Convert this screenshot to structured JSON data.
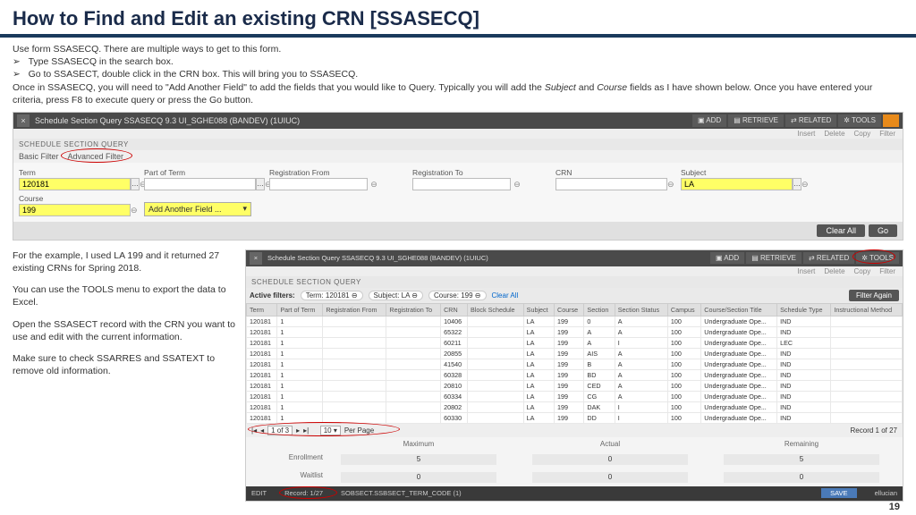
{
  "title": "How to Find and Edit an existing CRN   [SSASECQ]",
  "intro": {
    "l1": "Use form SSASECQ. There are multiple ways to get to this form.",
    "b1": "Type SSASECQ in the search box.",
    "b2": "Go to SSASECT, double click in the CRN box. This will bring you to SSASECQ.",
    "l2a": "Once in SSASECQ, you will need to \"Add Another Field\" to add the fields that you would like to Query. Typically you will add the ",
    "l2b": "Subject",
    "l2c": " and ",
    "l2d": "Course",
    "l2e": " fields as I have shown below. Once you have entered your criteria, press F8 to execute query or press the Go button."
  },
  "win1": {
    "title": "Schedule Section Query SSASECQ 9.3 UI_SGHE088 (BANDEV) (1UIUC)",
    "btns": {
      "add": "ADD",
      "retrieve": "RETRIEVE",
      "related": "RELATED",
      "tools": "TOOLS"
    },
    "sub": {
      "insert": "Insert",
      "delete": "Delete",
      "copy": "Copy",
      "filter": "Filter"
    },
    "section_label": "SCHEDULE SECTION QUERY",
    "basic": "Basic Filter",
    "advanced": "Advanced Filter",
    "fields": {
      "term": {
        "label": "Term",
        "value": "120181"
      },
      "pot": {
        "label": "Part of Term",
        "value": ""
      },
      "rf": {
        "label": "Registration From",
        "value": ""
      },
      "rt": {
        "label": "Registration To",
        "value": ""
      },
      "crn": {
        "label": "CRN",
        "value": ""
      },
      "subj": {
        "label": "Subject",
        "value": "LA"
      },
      "course": {
        "label": "Course",
        "value": "199"
      }
    },
    "addfield": "Add Another Field ...",
    "clearall": "Clear All",
    "go": "Go"
  },
  "left": {
    "p1": "For the example, I used LA 199 and it returned 27 existing CRNs for Spring 2018.",
    "p2": "You can use the TOOLS menu to export the data to Excel.",
    "p3": "Open the SSASECT record with the CRN you want to use and edit with the current information.",
    "p4": "Make sure to check SSARRES and SSATEXT to remove old information."
  },
  "win2": {
    "title": "Schedule Section Query SSASECQ 9.3 UI_SGHE088 (BANDEV) (1UIUC)",
    "section_label": "SCHEDULE SECTION QUERY",
    "af_label": "Active filters:",
    "af": {
      "term": "Term: 120181",
      "subj": "Subject: LA",
      "course": "Course: 199"
    },
    "clearall": "Clear All",
    "filteragain": "Filter Again",
    "cols": [
      "Term",
      "Part of Term",
      "Registration From",
      "Registration To",
      "CRN",
      "Block Schedule",
      "Subject",
      "Course",
      "Section",
      "Section Status",
      "Campus",
      "Course/Section Title",
      "Schedule Type",
      "Instructional Method"
    ],
    "rows": [
      [
        "120181",
        "1",
        "",
        "",
        "10406",
        "",
        "LA",
        "199",
        "0",
        "A",
        "100",
        "Undergraduate Ope...",
        "IND",
        ""
      ],
      [
        "120181",
        "1",
        "",
        "",
        "65322",
        "",
        "LA",
        "199",
        "A",
        "A",
        "100",
        "Undergraduate Ope...",
        "IND",
        ""
      ],
      [
        "120181",
        "1",
        "",
        "",
        "60211",
        "",
        "LA",
        "199",
        "A",
        "I",
        "100",
        "Undergraduate Ope...",
        "LEC",
        ""
      ],
      [
        "120181",
        "1",
        "",
        "",
        "20855",
        "",
        "LA",
        "199",
        "AIS",
        "A",
        "100",
        "Undergraduate Ope...",
        "IND",
        ""
      ],
      [
        "120181",
        "1",
        "",
        "",
        "41540",
        "",
        "LA",
        "199",
        "B",
        "A",
        "100",
        "Undergraduate Ope...",
        "IND",
        ""
      ],
      [
        "120181",
        "1",
        "",
        "",
        "60328",
        "",
        "LA",
        "199",
        "BD",
        "A",
        "100",
        "Undergraduate Ope...",
        "IND",
        ""
      ],
      [
        "120181",
        "1",
        "",
        "",
        "20810",
        "",
        "LA",
        "199",
        "CED",
        "A",
        "100",
        "Undergraduate Ope...",
        "IND",
        ""
      ],
      [
        "120181",
        "1",
        "",
        "",
        "60334",
        "",
        "LA",
        "199",
        "CG",
        "A",
        "100",
        "Undergraduate Ope...",
        "IND",
        ""
      ],
      [
        "120181",
        "1",
        "",
        "",
        "20802",
        "",
        "LA",
        "199",
        "DAK",
        "I",
        "100",
        "Undergraduate Ope...",
        "IND",
        ""
      ],
      [
        "120181",
        "1",
        "",
        "",
        "60330",
        "",
        "LA",
        "199",
        "DD",
        "I",
        "100",
        "Undergraduate Ope...",
        "IND",
        ""
      ]
    ],
    "pager": {
      "pos": "1 of 3",
      "perpage": "10",
      "pplabel": "Per Page",
      "record": "Record 1 of 27"
    },
    "summary": {
      "max": "Maximum",
      "actual": "Actual",
      "remain": "Remaining",
      "enroll_lbl": "Enrollment",
      "wait_lbl": "Waitlist",
      "enroll": [
        "5",
        "0",
        "5"
      ],
      "wait": [
        "0",
        "0",
        "0"
      ]
    },
    "foot": {
      "edit": "EDIT",
      "rec": "Record: 1/27",
      "field": "SOBSECT.SSBSECT_TERM_CODE (1)",
      "save": "SAVE",
      "brand": "ellucian"
    }
  },
  "pagenum": "19"
}
